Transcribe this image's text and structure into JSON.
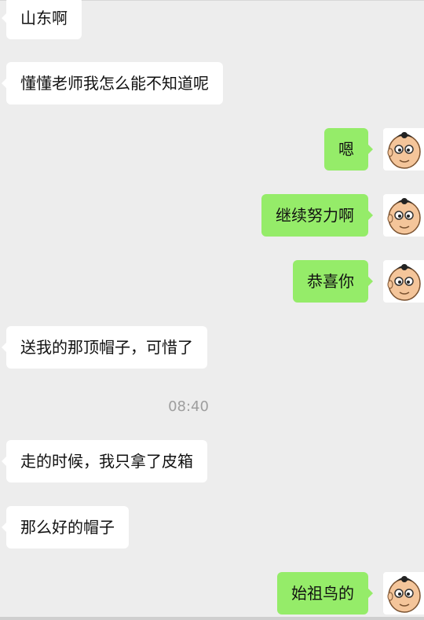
{
  "messages": [
    {
      "side": "in",
      "text": "山东啊"
    },
    {
      "side": "in",
      "text": "懂懂老师我怎么能不知道呢"
    },
    {
      "side": "out",
      "text": "嗯"
    },
    {
      "side": "out",
      "text": "继续努力啊"
    },
    {
      "side": "out",
      "text": "恭喜你"
    },
    {
      "side": "in",
      "text": "送我的那顶帽子，可惜了"
    },
    {
      "side": "in",
      "text": "走的时候，我只拿了皮箱"
    },
    {
      "side": "in",
      "text": "那么好的帽子"
    },
    {
      "side": "out",
      "text": "始祖鸟的"
    }
  ],
  "timestamp": "08:40",
  "colors": {
    "background": "#ededed",
    "incoming_bubble": "#ffffff",
    "outgoing_bubble": "#95ec69",
    "timestamp_text": "#9e9e9e"
  },
  "avatar_icon": "cartoon-boy-face-icon"
}
